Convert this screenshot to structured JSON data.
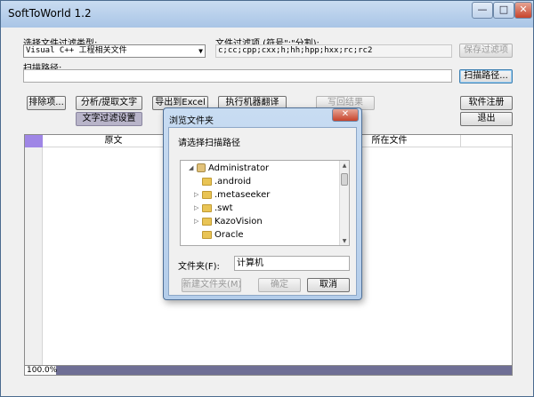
{
  "window": {
    "title": "SoftToWorld 1.2",
    "minimize": "—",
    "maximize": "□",
    "close": "✕"
  },
  "filter_type": {
    "label": "选择文件过滤类型:",
    "selected": "Visual C++ 工程相关文件"
  },
  "filter_options": {
    "label": "文件过滤项 (符号\";\"分割):",
    "value": "c;cc;cpp;cxx;h;hh;hpp;hxx;rc;rc2",
    "save_button": "保存过滤项"
  },
  "scan_path": {
    "label": "扫描路径:",
    "value": "",
    "button": "扫描路径..."
  },
  "toolbar": {
    "exclude": "排除项...",
    "analyze": "分析/提取文字",
    "export_excel": "导出到Excel",
    "machine_translate": "执行机器翻译",
    "write_back": "写回结果",
    "register": "软件注册",
    "text_filter": "文字过滤设置",
    "exit": "退出"
  },
  "table": {
    "columns": [
      "原文",
      "所在文件"
    ]
  },
  "status": {
    "progress": "100.0%"
  },
  "dialog": {
    "title": "浏览文件夹",
    "close": "✕",
    "prompt": "请选择扫描路径",
    "tree": [
      {
        "label": "Administrator",
        "expanded": true
      },
      {
        "label": ".android",
        "expanded": false
      },
      {
        "label": ".metaseeker",
        "expanded": false
      },
      {
        "label": ".swt",
        "expanded": false
      },
      {
        "label": "KazoVision",
        "expanded": false
      },
      {
        "label": "Oracle",
        "expanded": false
      }
    ],
    "folder_label": "文件夹(F):",
    "folder_value": "计算机",
    "new_folder": "新建文件夹(M)",
    "ok": "确定",
    "cancel": "取消"
  },
  "colors": {
    "title_gradient": "#a9c5e6",
    "accent": "#9f86e6",
    "dialog_border": "#4f6f96"
  }
}
